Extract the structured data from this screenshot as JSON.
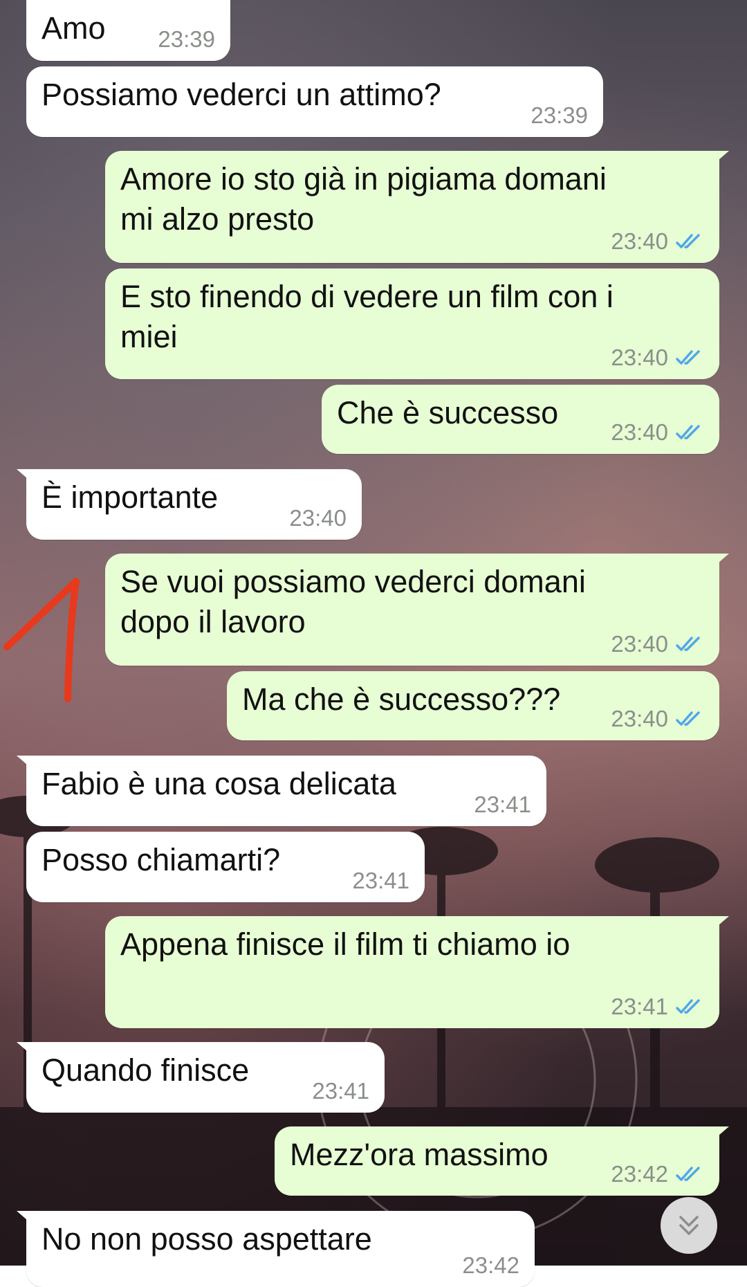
{
  "messages": [
    {
      "dir": "in",
      "text": "Amo",
      "time": "23:39"
    },
    {
      "dir": "in",
      "text": "Possiamo vederci un attimo?",
      "time": "23:39"
    },
    {
      "dir": "out",
      "text": "Amore io sto già in pigiama domani\nmi alzo presto",
      "time": "23:40",
      "status": "read"
    },
    {
      "dir": "out",
      "text": "E sto finendo di vedere un film con i\nmiei",
      "time": "23:40",
      "status": "read"
    },
    {
      "dir": "out",
      "text": "Che è successo",
      "time": "23:40",
      "status": "read"
    },
    {
      "dir": "in",
      "text": "È importante",
      "time": "23:40"
    },
    {
      "dir": "out",
      "text": "Se vuoi possiamo vederci domani\ndopo il lavoro",
      "time": "23:40",
      "status": "read"
    },
    {
      "dir": "out",
      "text": "Ma che è successo???",
      "time": "23:40",
      "status": "read"
    },
    {
      "dir": "in",
      "text": "Fabio è una cosa delicata",
      "time": "23:41"
    },
    {
      "dir": "in",
      "text": "Posso chiamarti?",
      "time": "23:41"
    },
    {
      "dir": "out",
      "text": "Appena finisce il film ti chiamo io",
      "time": "23:41",
      "status": "read"
    },
    {
      "dir": "in",
      "text": "Quando finisce",
      "time": "23:41"
    },
    {
      "dir": "out",
      "text": "Mezz'ora massimo",
      "time": "23:42",
      "status": "read"
    },
    {
      "dir": "in",
      "text": "No non posso aspettare",
      "time": "23:42"
    }
  ],
  "colors": {
    "incoming_bubble": "#ffffff",
    "outgoing_bubble": "#e7fdd4",
    "read_tick": "#4fa8e8",
    "annotation_arrow": "#e8391c"
  },
  "icons": {
    "read_receipt": "double-check-icon",
    "scroll_down": "double-chevron-down-icon"
  }
}
